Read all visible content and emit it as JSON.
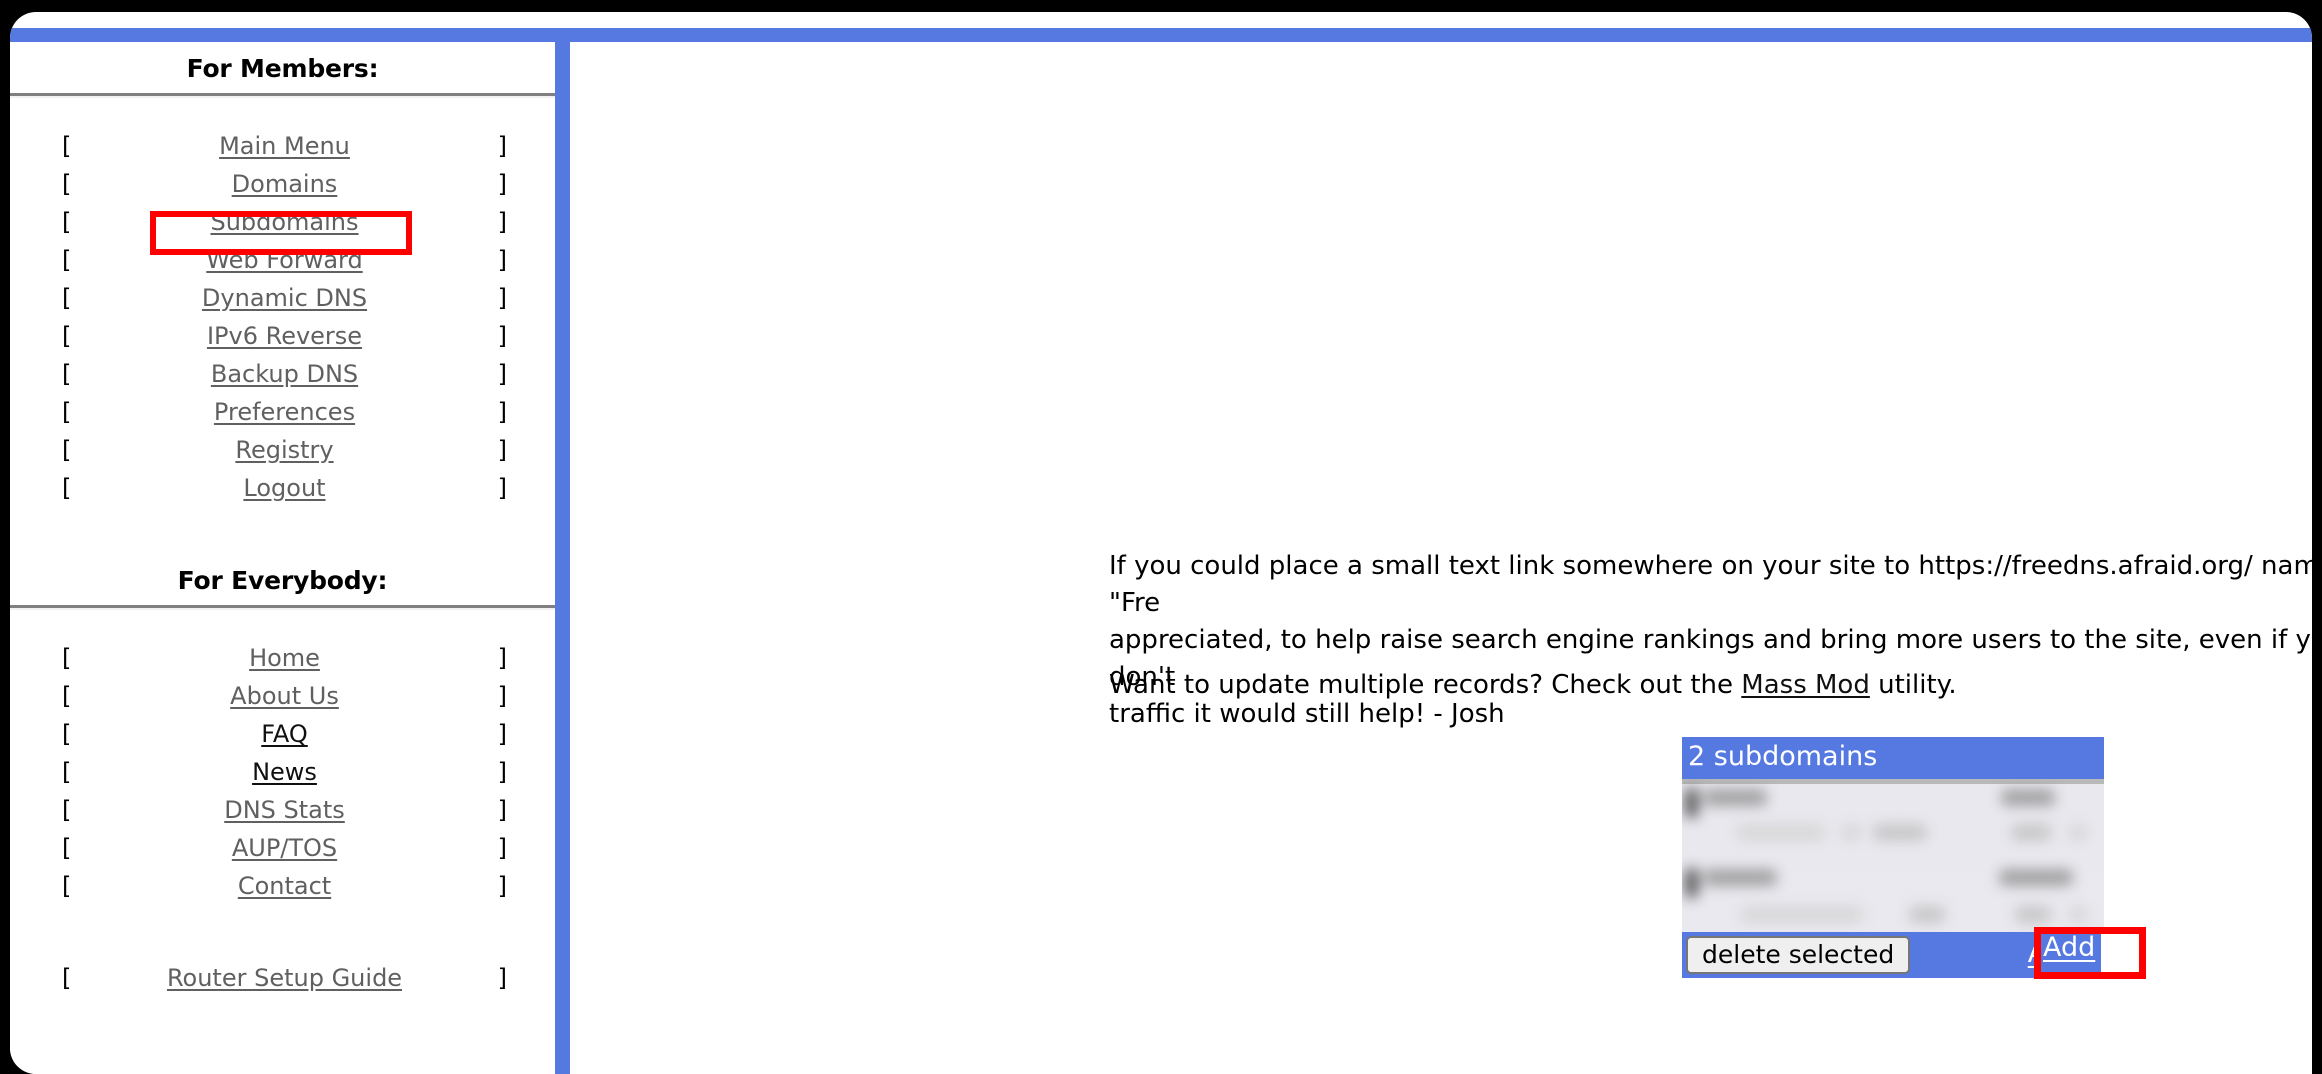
{
  "window": {
    "accent_blue": "#5579e0",
    "highlight_red": "#fe0000"
  },
  "sidebar": {
    "members_heading": "For Members:",
    "everybody_heading": "For Everybody:",
    "bracket_open": "[",
    "bracket_close": "]",
    "members_items": [
      {
        "label": "Main Menu",
        "visited": false
      },
      {
        "label": "Domains",
        "visited": false
      },
      {
        "label": "Subdomains",
        "visited": false
      },
      {
        "label": "Web Forward",
        "visited": false
      },
      {
        "label": "Dynamic DNS",
        "visited": false
      },
      {
        "label": "IPv6 Reverse",
        "visited": false
      },
      {
        "label": "Backup DNS",
        "visited": false
      },
      {
        "label": "Preferences",
        "visited": false
      },
      {
        "label": "Registry",
        "visited": false
      },
      {
        "label": "Logout",
        "visited": false
      }
    ],
    "everybody_items": [
      {
        "label": "Home",
        "visited": false
      },
      {
        "label": "About Us",
        "visited": false
      },
      {
        "label": "FAQ",
        "visited": true
      },
      {
        "label": "News",
        "visited": true
      },
      {
        "label": "DNS Stats",
        "visited": false
      },
      {
        "label": "AUP/TOS",
        "visited": false
      },
      {
        "label": "Contact",
        "visited": false
      }
    ],
    "footer_items": [
      {
        "label": "Router Setup Guide",
        "visited": false
      }
    ]
  },
  "main": {
    "promo_paragraph": "If you could place a small text link somewhere on your site to https://freedns.afraid.org/ named \"Fre\nappreciated, to help raise search engine rankings and bring more users to the site, even if you don't\ntraffic it would still help! - Josh",
    "massmod_prefix": "Want to update multiple records? Check out the ",
    "massmod_link": "Mass Mod",
    "massmod_suffix": " utility."
  },
  "subdomain_panel": {
    "title": "2 subdomains",
    "delete_button": "delete selected",
    "add_link": "Add",
    "row_count": 2,
    "rows_redacted": true
  }
}
